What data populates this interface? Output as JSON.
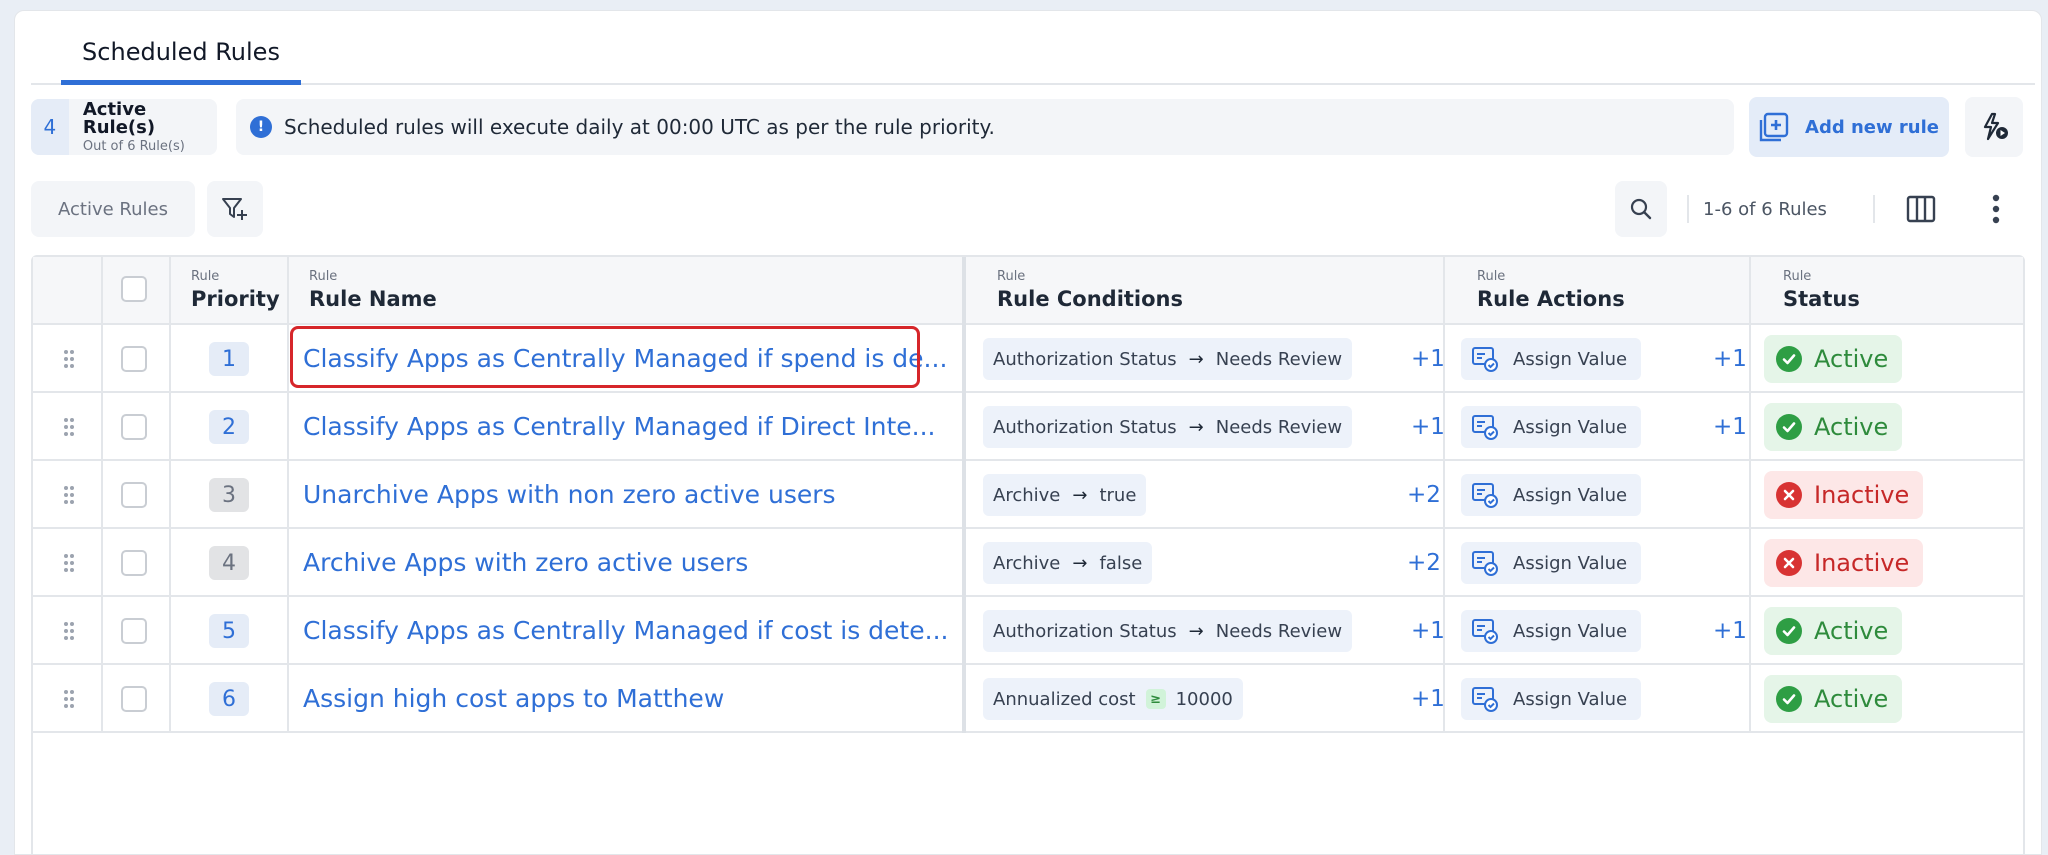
{
  "tab": {
    "label": "Scheduled Rules"
  },
  "counter": {
    "count": "4",
    "title": "Active Rule(s)",
    "subtitle": "Out of 6 Rule(s)"
  },
  "banner": {
    "icon": "info-icon",
    "text": "Scheduled rules will execute daily at 00:00 UTC as per the rule priority."
  },
  "toolbar": {
    "add_label": "Add new rule",
    "filter_label": "Active Rules",
    "pagination": "1-6 of 6 Rules"
  },
  "columns": {
    "priority": {
      "small": "Rule",
      "big": "Priority"
    },
    "name": {
      "small": "Rule",
      "big": "Rule Name"
    },
    "conditions": {
      "small": "Rule",
      "big": "Rule Conditions"
    },
    "actions": {
      "small": "Rule",
      "big": "Rule Actions"
    },
    "status": {
      "small": "Rule",
      "big": "Status"
    }
  },
  "colors": {
    "accent": "#2f6fd6",
    "active": "#2e9e44",
    "inactive": "#d83333",
    "highlight": "#d6262a"
  },
  "rows": [
    {
      "priority": "1",
      "name": "Classify Apps as Centrally Managed if spend is de...",
      "cond_field": "Authorization Status",
      "cond_op": "→",
      "cond_value": "Needs Review",
      "cond_more": "+1",
      "action": "Assign Value",
      "action_more": "+1",
      "status": "Active"
    },
    {
      "priority": "2",
      "name": "Classify Apps as Centrally Managed if Direct Inte...",
      "cond_field": "Authorization Status",
      "cond_op": "→",
      "cond_value": "Needs Review",
      "cond_more": "+1",
      "action": "Assign Value",
      "action_more": "+1",
      "status": "Active"
    },
    {
      "priority": "3",
      "name": "Unarchive Apps with non zero active users",
      "cond_field": "Archive",
      "cond_op": "→",
      "cond_value": "true",
      "cond_more": "+2",
      "action": "Assign Value",
      "action_more": "",
      "status": "Inactive"
    },
    {
      "priority": "4",
      "name": "Archive Apps with zero active users",
      "cond_field": "Archive",
      "cond_op": "→",
      "cond_value": "false",
      "cond_more": "+2",
      "action": "Assign Value",
      "action_more": "",
      "status": "Inactive"
    },
    {
      "priority": "5",
      "name": "Classify Apps as Centrally Managed if cost is dete...",
      "cond_field": "Authorization Status",
      "cond_op": "→",
      "cond_value": "Needs Review",
      "cond_more": "+1",
      "action": "Assign Value",
      "action_more": "+1",
      "status": "Active"
    },
    {
      "priority": "6",
      "name": "Assign high cost apps to Matthew",
      "cond_field": "Annualized cost",
      "cond_op": "≥",
      "cond_value": "10000",
      "cond_more": "+1",
      "action": "Assign Value",
      "action_more": "",
      "status": "Active"
    }
  ]
}
